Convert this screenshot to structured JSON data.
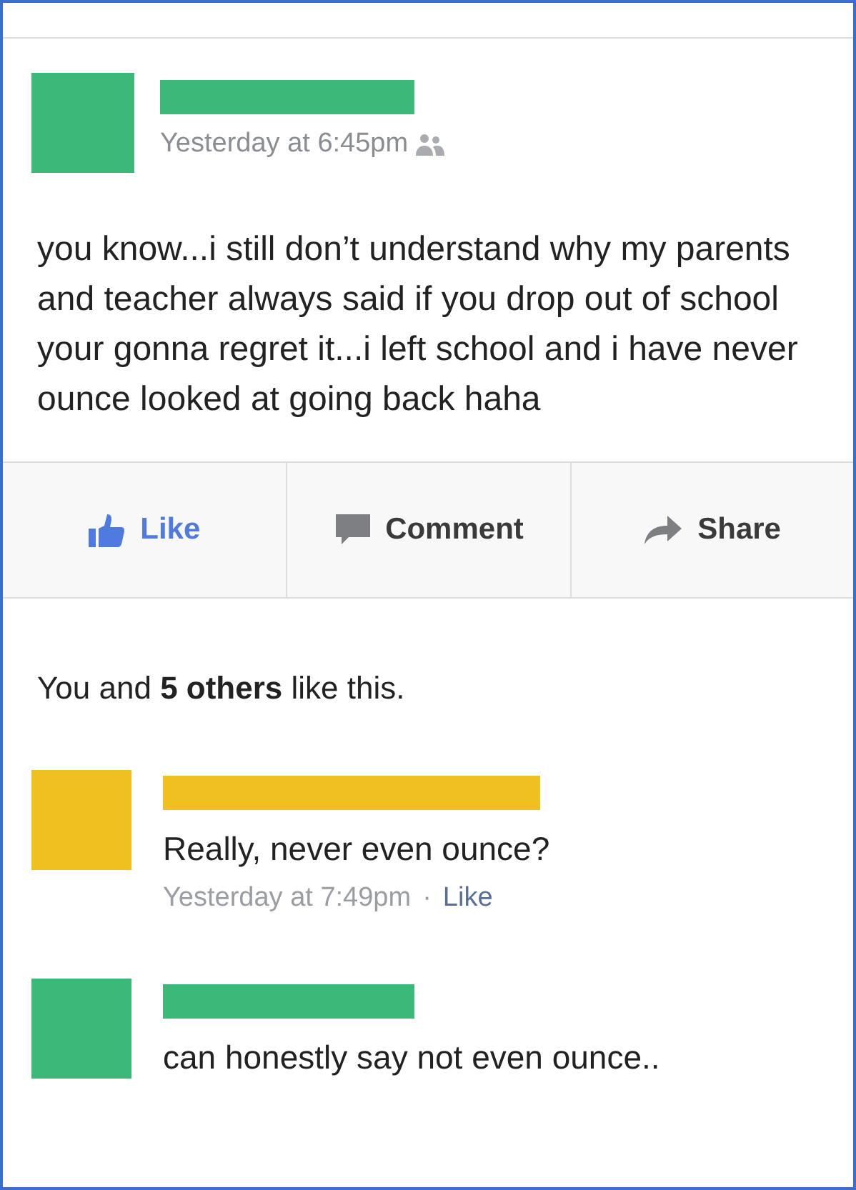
{
  "post": {
    "author": {
      "color": "#3cb878"
    },
    "time": "Yesterday at 6:45pm",
    "text": "you know...i still don’t understand why my parents and teacher always said if you drop out of school your gonna regret it...i left school and i have never ounce looked at going back haha"
  },
  "actions": [
    {
      "kind": "like",
      "label": "Like",
      "selected": true
    },
    {
      "kind": "comment",
      "label": "Comment",
      "selected": false
    },
    {
      "kind": "share",
      "label": "Share",
      "selected": false
    }
  ],
  "likes_summary": "You and **5 others** like this.",
  "comments": [
    {
      "color": "#f0c020",
      "text": "Really, never even ounce?",
      "time": "Yesterday at 7:49pm",
      "separator": "·",
      "like": "Like"
    },
    {
      "color": "#3cb878",
      "text": "can honestly say not even ounce.."
    }
  ]
}
